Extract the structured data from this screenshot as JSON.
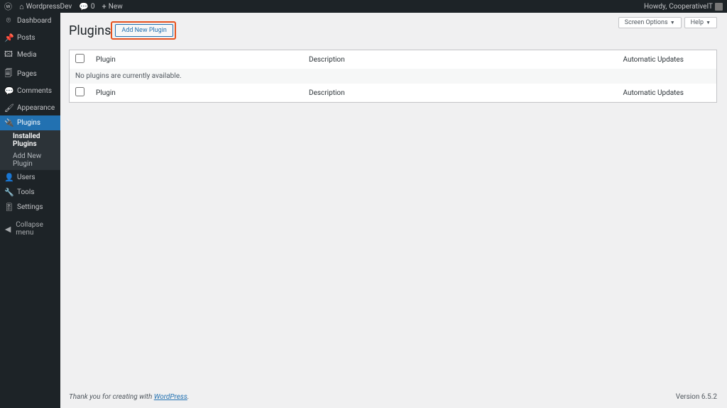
{
  "adminBar": {
    "siteName": "WordpressDev",
    "commentsCount": "0",
    "newLabel": "New",
    "howdyPrefix": "Howdy,",
    "userName": "CooperativeIT"
  },
  "sidebar": {
    "dashboard": "Dashboard",
    "posts": "Posts",
    "media": "Media",
    "pages": "Pages",
    "comments": "Comments",
    "appearance": "Appearance",
    "plugins": "Plugins",
    "pluginsSub": {
      "installed": "Installed Plugins",
      "addNew": "Add New Plugin"
    },
    "users": "Users",
    "tools": "Tools",
    "settings": "Settings",
    "collapse": "Collapse menu"
  },
  "topButtons": {
    "screenOptions": "Screen Options",
    "help": "Help"
  },
  "page": {
    "title": "Plugins",
    "addNew": "Add New Plugin"
  },
  "table": {
    "colPlugin": "Plugin",
    "colDescription": "Description",
    "colAuto": "Automatic Updates",
    "emptyMessage": "No plugins are currently available."
  },
  "footer": {
    "thankYou": "Thank you for creating with ",
    "link": "WordPress",
    "version": "Version 6.5.2"
  }
}
